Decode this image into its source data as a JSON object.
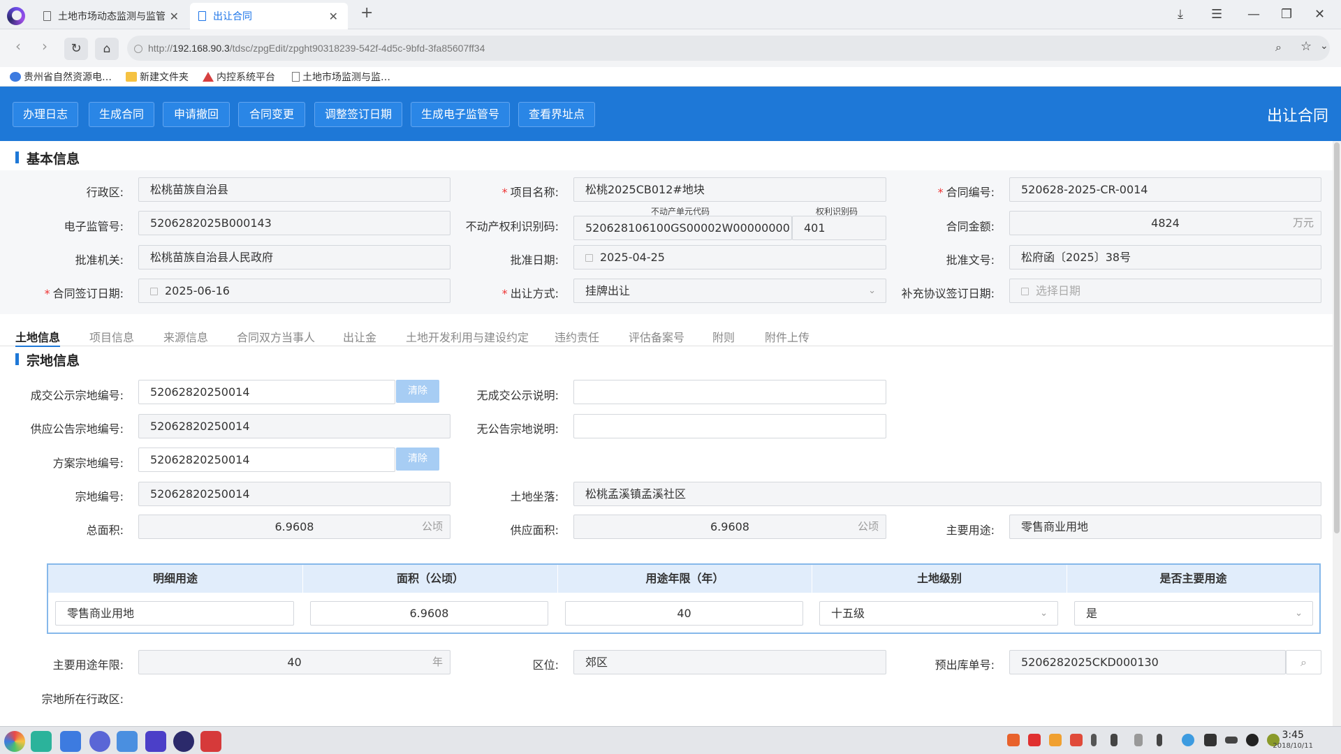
{
  "browser": {
    "tabs": [
      {
        "title": "土地市场动态监测与监管",
        "active": false
      },
      {
        "title": "出让合同",
        "active": true
      }
    ],
    "url_prefix": "http://",
    "url_host": "192.168.90.3",
    "url_path": "/tdsc/zpgEdit/zpght90318239-542f-4d5c-9bfd-3fa85607ff34",
    "bookmarks": [
      "贵州省自然资源电…",
      "新建文件夹",
      "内控系统平台",
      "土地市场监测与监…"
    ]
  },
  "toolbar": {
    "buttons": [
      "办理日志",
      "生成合同",
      "申请撤回",
      "合同变更",
      "调整签订日期",
      "生成电子监管号",
      "查看界址点"
    ],
    "title": "出让合同"
  },
  "basic": {
    "section_title": "基本信息",
    "district_label": "行政区:",
    "district": "松桃苗族自治县",
    "project_label": "项目名称:",
    "project": "松桃2025CB012#地块",
    "contract_no_label": "合同编号:",
    "contract_no": "520628-2025-CR-0014",
    "supervision_label": "电子监管号:",
    "supervision_no": "5206282025B000143",
    "realty_label": "不动产权利识别码:",
    "realty_unit_caption": "不动产单元代码",
    "realty_unit": "520628106100GS00002W00000000",
    "right_caption": "权利识别码",
    "right_code": "401",
    "amount_label": "合同金额:",
    "amount": "4824",
    "amount_unit": "万元",
    "approval_org_label": "批准机关:",
    "approval_org": "松桃苗族自治县人民政府",
    "approval_date_label": "批准日期:",
    "approval_date": "2025-04-25",
    "approval_doc_label": "批准文号:",
    "approval_doc": "松府函〔2025〕38号",
    "sign_date_label": "合同签订日期:",
    "sign_date": "2025-06-16",
    "transfer_label": "出让方式:",
    "transfer_mode": "挂牌出让",
    "supp_date_label": "补充协议签订日期:",
    "supp_date_placeholder": "选择日期"
  },
  "content_tabs": [
    "土地信息",
    "项目信息",
    "来源信息",
    "合同双方当事人",
    "出让金",
    "土地开发利用与建设约定",
    "违约责任",
    "评估备案号",
    "附则",
    "附件上传"
  ],
  "parcel": {
    "section_title": "宗地信息",
    "deal_no_label": "成交公示宗地编号:",
    "deal_no": "52062820250014",
    "clear_label": "清除",
    "no_deal_label": "无成交公示说明:",
    "no_deal": "",
    "supply_no_label": "供应公告宗地编号:",
    "supply_no": "52062820250014",
    "no_notice_label": "无公告宗地说明:",
    "no_notice": "",
    "plan_no_label": "方案宗地编号:",
    "plan_no": "52062820250014",
    "parcel_no_label": "宗地编号:",
    "parcel_no": "52062820250014",
    "location_label": "土地坐落:",
    "location": "松桃孟溪镇孟溪社区",
    "total_area_label": "总面积:",
    "total_area": "6.9608",
    "supply_area_label": "供应面积:",
    "supply_area": "6.9608",
    "area_unit": "公顷",
    "main_use_label": "主要用途:",
    "main_use": "零售商业用地",
    "grid_headers": [
      "明细用途",
      "面积（公顷）",
      "用途年限（年）",
      "土地级别",
      "是否主要用途"
    ],
    "grid_row": [
      "零售商业用地",
      "6.9608",
      "40",
      "十五级",
      "是"
    ],
    "main_years_label": "主要用途年限:",
    "main_years": "40",
    "years_unit": "年",
    "zone_label": "区位:",
    "zone": "郊区",
    "outbound_label": "预出库单号:",
    "outbound_no": "5206282025CKD000130",
    "parcel_district_label": "宗地所在行政区:"
  },
  "taskbar": {
    "time": "3:45",
    "date": "2018/10/11"
  }
}
